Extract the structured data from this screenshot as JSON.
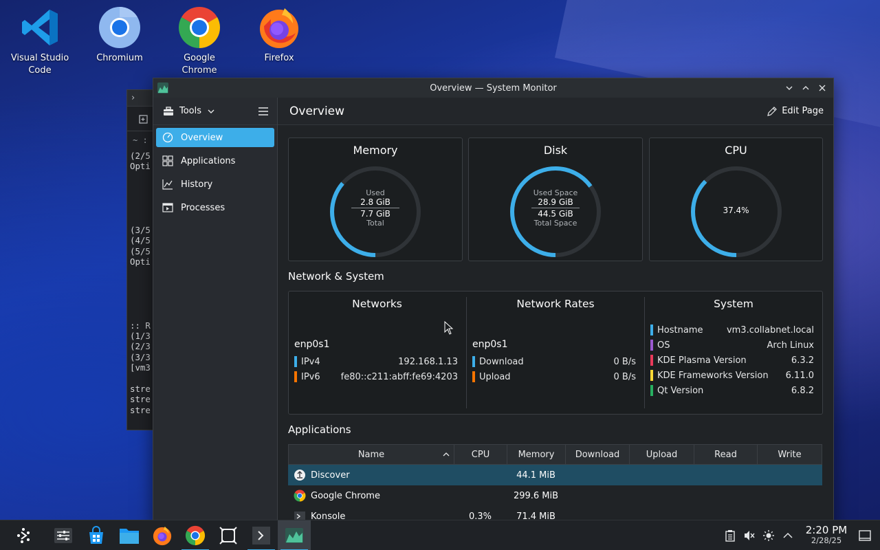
{
  "desktop": {
    "icons": [
      {
        "label": "Visual Studio Code",
        "icon": "vscode-icon"
      },
      {
        "label": "Chromium",
        "icon": "chromium-icon"
      },
      {
        "label": "Google Chrome",
        "icon": "chrome-icon"
      },
      {
        "label": "Firefox",
        "icon": "firefox-icon"
      }
    ]
  },
  "terminal": {
    "path": "~ : ba",
    "lines": "(2/5\nOpti\n\n\n\n\n\n(3/5\n(4/5\n(5/5\nOpti\n\n\n\n\n\n:: R\n(1/3\n(2/3\n(3/3\n[vm3\n\nstre\nstre\nstre"
  },
  "window": {
    "title": "Overview — System Monitor",
    "sidebar": {
      "tools_label": "Tools",
      "items": [
        {
          "label": "Overview",
          "icon": "overview-icon",
          "active": true
        },
        {
          "label": "Applications",
          "icon": "applications-icon"
        },
        {
          "label": "History",
          "icon": "history-icon"
        },
        {
          "label": "Processes",
          "icon": "processes-icon"
        }
      ]
    },
    "page_title": "Overview",
    "edit_page_label": "Edit Page",
    "memory": {
      "title": "Memory",
      "used_label": "Used",
      "used": "2.8 GiB",
      "total": "7.7 GiB",
      "total_label": "Total",
      "fraction": 0.364
    },
    "disk": {
      "title": "Disk",
      "used_label": "Used Space",
      "used": "28.9 GiB",
      "total": "44.5 GiB",
      "total_label": "Total Space",
      "fraction": 0.65
    },
    "cpu": {
      "title": "CPU",
      "value": "37.4%",
      "fraction": 0.374
    },
    "network_system_title": "Network & System",
    "networks": {
      "title": "Networks",
      "interface": "enp0s1",
      "rows": [
        {
          "key": "IPv4",
          "value": "192.168.1.13",
          "color": "#3daee9"
        },
        {
          "key": "IPv6",
          "value": "fe80::c211:abff:fe69:4203",
          "color": "#f67400"
        }
      ]
    },
    "network_rates": {
      "title": "Network Rates",
      "interface": "enp0s1",
      "rows": [
        {
          "key": "Download",
          "value": "0 B/s",
          "color": "#3daee9"
        },
        {
          "key": "Upload",
          "value": "0 B/s",
          "color": "#f67400"
        }
      ]
    },
    "system": {
      "title": "System",
      "rows": [
        {
          "key": "Hostname",
          "value": "vm3.collabnet.local",
          "color": "#3daee9"
        },
        {
          "key": "OS",
          "value": "Arch Linux",
          "color": "#9b59d0"
        },
        {
          "key": "KDE Plasma Version",
          "value": "6.3.2",
          "color": "#e93a5a"
        },
        {
          "key": "KDE Frameworks Version",
          "value": "6.11.0",
          "color": "#fdd835"
        },
        {
          "key": "Qt Version",
          "value": "6.8.2",
          "color": "#27ae60"
        }
      ]
    },
    "applications_title": "Applications",
    "table": {
      "columns": [
        "Name",
        "CPU",
        "Memory",
        "Download",
        "Upload",
        "Read",
        "Write"
      ],
      "rows": [
        {
          "name": "Discover",
          "cpu": "",
          "memory": "44.1 MiB",
          "download": "",
          "upload": "",
          "read": "",
          "write": "",
          "icon": "discover-icon",
          "selected": true
        },
        {
          "name": "Google Chrome",
          "cpu": "",
          "memory": "299.6 MiB",
          "download": "",
          "upload": "",
          "read": "",
          "write": "",
          "icon": "chrome-icon"
        },
        {
          "name": "Konsole",
          "cpu": "0.3%",
          "memory": "71.4 MiB",
          "download": "",
          "upload": "",
          "read": "",
          "write": "",
          "icon": "konsole-icon"
        }
      ]
    }
  },
  "taskbar": {
    "items": [
      "application-launcher-icon",
      "system-settings-icon",
      "discover-icon",
      "dolphin-icon",
      "firefox-icon",
      "chrome-icon",
      "window-overview-icon",
      "konsole-icon",
      "system-monitor-icon"
    ],
    "tray": [
      "clipboard-icon",
      "volume-muted-icon",
      "brightness-icon",
      "tray-expand-icon"
    ],
    "time": "2:20 PM",
    "date": "2/28/25"
  },
  "colors": {
    "accent": "#3daee9",
    "window_bg": "#202326",
    "card_bg": "#1b1e20"
  }
}
